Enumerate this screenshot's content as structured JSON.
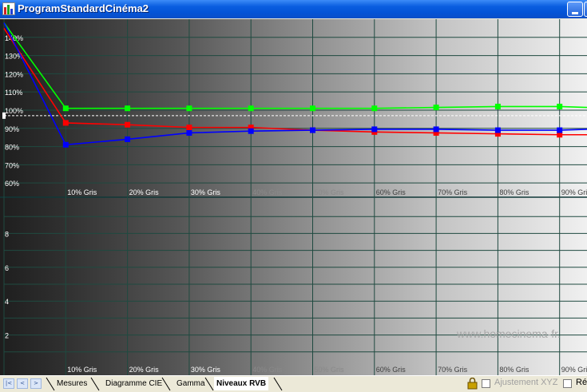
{
  "window": {
    "title": "ProgramStandardCinéma2",
    "minimize_icon": "minimize-icon",
    "maximize_icon": "maximize-icon"
  },
  "chart_data": [
    {
      "type": "line",
      "title": "",
      "y_ticks": [
        "140%",
        "130%",
        "120%",
        "110%",
        "100%",
        "90%",
        "80%",
        "70%",
        "60%"
      ],
      "y_tick_values": [
        140,
        130,
        120,
        110,
        100,
        90,
        80,
        70,
        60
      ],
      "ylim": [
        57,
        150
      ],
      "x_labels": [
        "10% Gris",
        "20% Gris",
        "30% Gris",
        "40% Gris",
        "50% Gris",
        "60% Gris",
        "70% Gris",
        "80% Gris",
        "90% Gris"
      ],
      "reference_line": 97,
      "grid": true,
      "series": [
        {
          "color": "#00ff00",
          "values": [
            148,
            101,
            101,
            101,
            101,
            101,
            101,
            101.5,
            102,
            102,
            101.5
          ]
        },
        {
          "color": "#ff0000",
          "values": [
            145,
            93,
            92,
            90.5,
            90.5,
            89,
            88,
            87.5,
            87,
            86.5,
            86.5
          ]
        },
        {
          "color": "#0000ff",
          "values": [
            148,
            81,
            84,
            87.5,
            88.5,
            89,
            89.5,
            89.5,
            89,
            89,
            89.5
          ]
        }
      ]
    },
    {
      "type": "line",
      "title": "",
      "y_ticks": [
        "8",
        "6",
        "4",
        "2"
      ],
      "y_tick_values": [
        8,
        6,
        4,
        2
      ],
      "ylim": [
        0,
        10
      ],
      "x_labels": [
        "10% Gris",
        "20% Gris",
        "30% Gris",
        "40% Gris",
        "50% Gris",
        "60% Gris",
        "70% Gris",
        "80% Gris",
        "90% Gris"
      ],
      "grid": true,
      "series": []
    }
  ],
  "watermark": "www.homecinema-fr.",
  "tabs": [
    {
      "label": "Mesures",
      "active": false
    },
    {
      "label": "Diagramme CIE",
      "active": false
    },
    {
      "label": "Gamma",
      "active": false
    },
    {
      "label": "Niveaux RVB",
      "active": true
    }
  ],
  "nav_buttons": [
    "|<",
    "<",
    ">"
  ],
  "options": {
    "ajustement_label": "Ajustement XYZ",
    "truncated_label": "Ré",
    "lock_icon": "lock-icon"
  }
}
